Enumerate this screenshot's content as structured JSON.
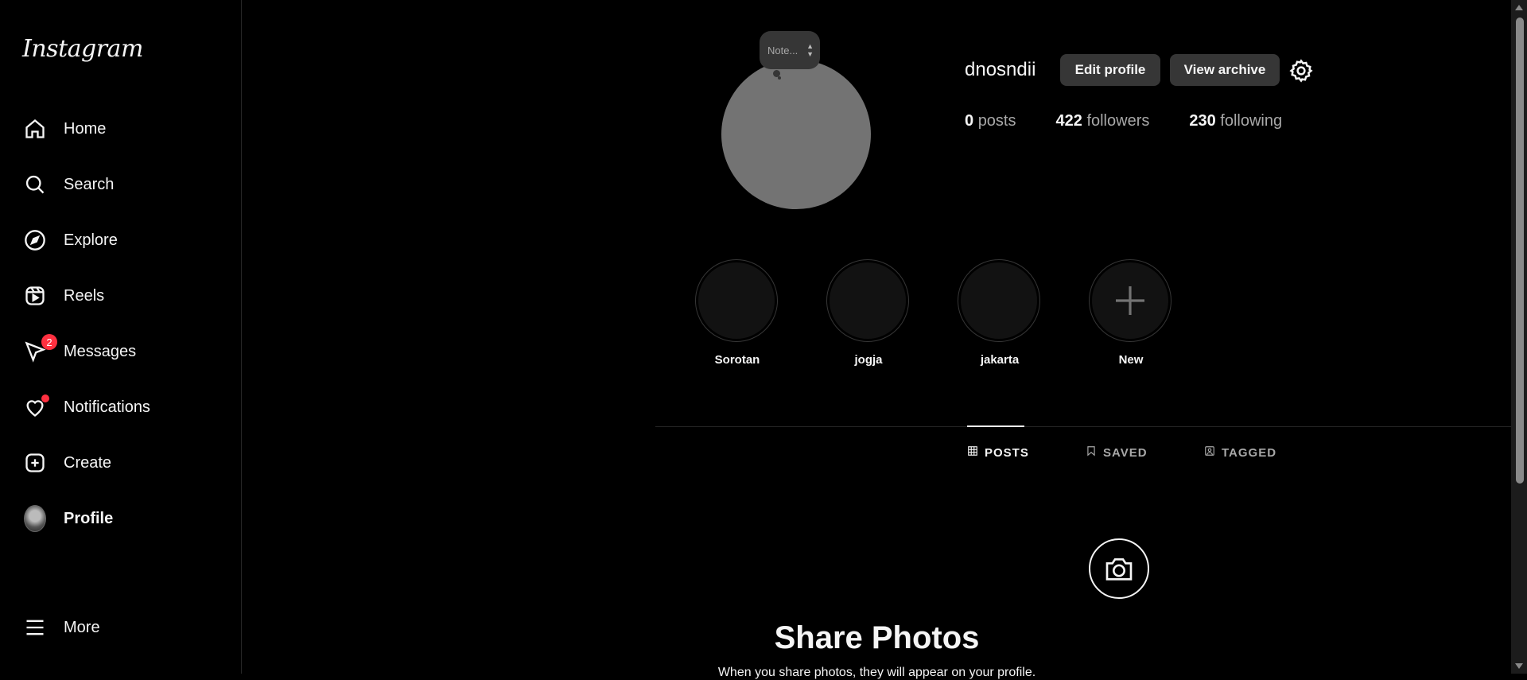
{
  "app": {
    "logo": "Instagram"
  },
  "sidebar": {
    "items": [
      {
        "label": "Home",
        "icon": "home-icon"
      },
      {
        "label": "Search",
        "icon": "search-icon"
      },
      {
        "label": "Explore",
        "icon": "compass-icon"
      },
      {
        "label": "Reels",
        "icon": "reels-icon"
      },
      {
        "label": "Messages",
        "icon": "messenger-icon",
        "badge": "2"
      },
      {
        "label": "Notifications",
        "icon": "heart-icon"
      },
      {
        "label": "Create",
        "icon": "plus-square-icon"
      },
      {
        "label": "Profile",
        "icon": "avatar"
      }
    ],
    "more": "More"
  },
  "profile": {
    "note_placeholder": "Note...",
    "username": "dnosndii",
    "edit_profile": "Edit profile",
    "view_archive": "View archive",
    "stats": {
      "posts_count": "0",
      "posts_label": "posts",
      "followers_count": "422",
      "followers_label": "followers",
      "following_count": "230",
      "following_label": "following"
    }
  },
  "highlights": [
    {
      "label": "Sorotan"
    },
    {
      "label": "jogja"
    },
    {
      "label": "jakarta"
    },
    {
      "label": "New"
    }
  ],
  "tabs": [
    {
      "label": "POSTS",
      "icon": "grid-icon"
    },
    {
      "label": "SAVED",
      "icon": "bookmark-icon"
    },
    {
      "label": "TAGGED",
      "icon": "tag-user-icon"
    }
  ],
  "empty_state": {
    "title": "Share Photos",
    "subtitle": "When you share photos, they will appear on your profile."
  },
  "colors": {
    "background": "#000000",
    "badge": "#ff3040",
    "button": "#363636"
  }
}
